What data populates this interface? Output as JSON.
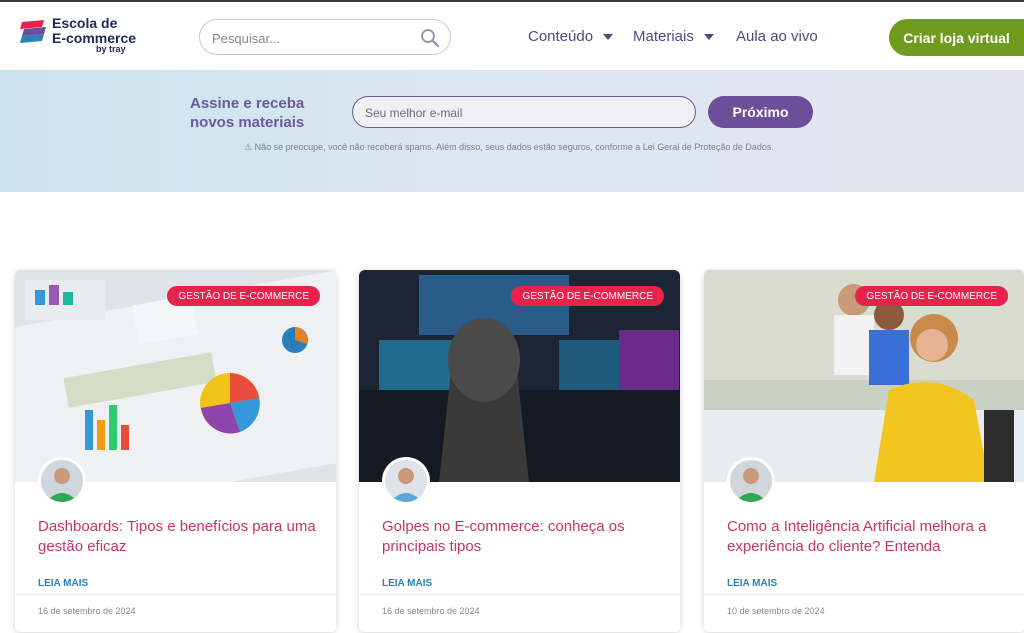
{
  "header": {
    "logo_line1": "Escola de",
    "logo_line2": "E-commerce",
    "logo_by": "by tray",
    "search_placeholder": "Pesquisar...",
    "nav": {
      "conteudo": "Conteúdo",
      "materiais": "Materiais",
      "aula": "Aula ao vivo"
    },
    "cta_label": "Criar loja virtual"
  },
  "newsletter": {
    "title_line1": "Assine e receba",
    "title_line2": "novos materiais",
    "email_placeholder": "Seu melhor e-mail",
    "button_label": "Próximo",
    "disclaimer": "⚠ Não se preocupe, você não receberá spams. Além disso, seus dados estão seguros, conforme a Lei Geral de Proteção de Dados."
  },
  "cards": [
    {
      "tag": "GESTÃO DE E-COMMERCE",
      "title": "Dashboards: Tipos e benefícios para uma gestão eficaz",
      "read_more": "LEIA MAIS",
      "date": "16 de setembro de 2024"
    },
    {
      "tag": "GESTÃO DE E-COMMERCE",
      "title": "Golpes no E-commerce: conheça os principais tipos",
      "read_more": "LEIA MAIS",
      "date": "16 de setembro de 2024"
    },
    {
      "tag": "GESTÃO DE E-COMMERCE",
      "title": "Como a Inteligência Artificial melhora a experiência do cliente? Entenda",
      "read_more": "LEIA MAIS",
      "date": "10 de setembro de 2024"
    }
  ],
  "colors": {
    "brand_green": "#6f9c1f",
    "brand_purple": "#6c4f99",
    "tag_red": "#e5234b",
    "title_pink": "#c4356a",
    "link_blue": "#2c7fb8"
  }
}
